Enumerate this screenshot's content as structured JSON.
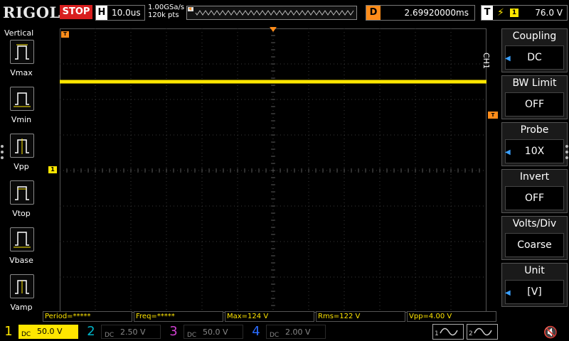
{
  "topbar": {
    "logo": "RIGOL",
    "run_state": "STOP",
    "horizontal_key": "H",
    "timebase": "10.0us",
    "sample_rate": "1.00GSa/s",
    "memory_depth": "120k pts",
    "delay_key": "D",
    "delay": "2.69920000ms",
    "trigger_key": "T",
    "trigger_edge": "rising-edge-icon",
    "trigger_source": "1",
    "trigger_level": "76.0 V"
  },
  "left_panel": {
    "title": "Vertical",
    "items": [
      {
        "label": "Vmax",
        "icon": "vmax-icon"
      },
      {
        "label": "Vmin",
        "icon": "vmin-icon"
      },
      {
        "label": "Vpp",
        "icon": "vpp-icon"
      },
      {
        "label": "Vtop",
        "icon": "vtop-icon"
      },
      {
        "label": "Vbase",
        "icon": "vbase-icon"
      },
      {
        "label": "Vamp",
        "icon": "vamp-icon"
      }
    ]
  },
  "grid": {
    "ch1_marker": "1",
    "trigger_marker": "T"
  },
  "right_menu": {
    "channel_label": "CH1",
    "items": [
      {
        "title": "Coupling",
        "value": "DC",
        "has_arrow": true
      },
      {
        "title": "BW Limit",
        "value": "OFF",
        "has_arrow": false
      },
      {
        "title": "Probe",
        "value": "10X",
        "has_arrow": true
      },
      {
        "title": "Invert",
        "value": "OFF",
        "has_arrow": false
      },
      {
        "title": "Volts/Div",
        "value": "Coarse",
        "has_arrow": false
      },
      {
        "title": "Unit",
        "value": "[V]",
        "has_arrow": true
      }
    ]
  },
  "measurements": [
    "Period=*****",
    "Freq=*****",
    "Max=124 V",
    "Rms=122 V",
    "Vpp=4.00 V"
  ],
  "channels": [
    {
      "num": "1",
      "scale": "50.0 V",
      "coupling": "DC",
      "color": "#ffe600",
      "active": true
    },
    {
      "num": "2",
      "scale": "2.50 V",
      "coupling": "DC",
      "color": "#00b4c8",
      "active": false
    },
    {
      "num": "3",
      "scale": "50.0 V",
      "coupling": "DC",
      "color": "#d040d0",
      "active": false
    },
    {
      "num": "4",
      "scale": "2.00 V",
      "coupling": "DC",
      "color": "#2a6cff",
      "active": false
    }
  ],
  "bottom_buttons": [
    {
      "num": "1",
      "icon": "sine-wave-icon"
    },
    {
      "num": "2",
      "icon": "sine-wave-icon"
    }
  ],
  "trace": {
    "channel": "1",
    "color": "#ffe600",
    "level_divisions_from_top": 1.5,
    "volts_per_div": 50.0
  },
  "speaker_icon": "speaker-muted-icon"
}
